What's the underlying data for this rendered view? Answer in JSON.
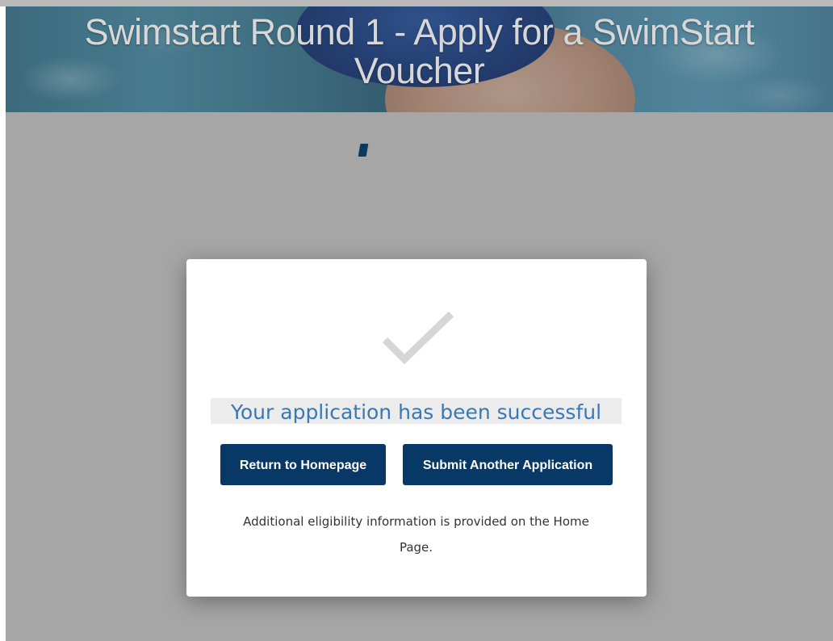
{
  "banner": {
    "title_line1": "Swimstart Round 1 - Apply for a SwimStart",
    "title_line2": "Voucher"
  },
  "modal": {
    "success_message": "Your application has been successful",
    "buttons": {
      "return_home": "Return to Homepage",
      "submit_another": "Submit Another Application"
    },
    "info_line1": "Additional eligibility information is provided on the Home",
    "info_line2": "Page."
  },
  "icons": {
    "success": "checkmark-icon",
    "loading": "loading-spinner-icon"
  },
  "colors": {
    "button_bg": "#073866",
    "success_text": "#3a78b5",
    "overlay": "#a6a6a6",
    "checkmark": "#d6d6d6"
  }
}
